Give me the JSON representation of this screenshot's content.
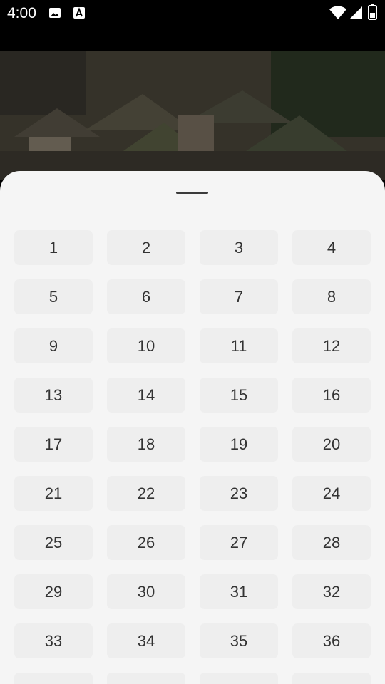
{
  "status_bar": {
    "time": "4:00"
  },
  "number_grid": {
    "items": [
      "1",
      "2",
      "3",
      "4",
      "5",
      "6",
      "7",
      "8",
      "9",
      "10",
      "11",
      "12",
      "13",
      "14",
      "15",
      "16",
      "17",
      "18",
      "19",
      "20",
      "21",
      "22",
      "23",
      "24",
      "25",
      "26",
      "27",
      "28",
      "29",
      "30",
      "31",
      "32",
      "33",
      "34",
      "35",
      "36",
      "",
      "",
      "",
      ""
    ]
  }
}
